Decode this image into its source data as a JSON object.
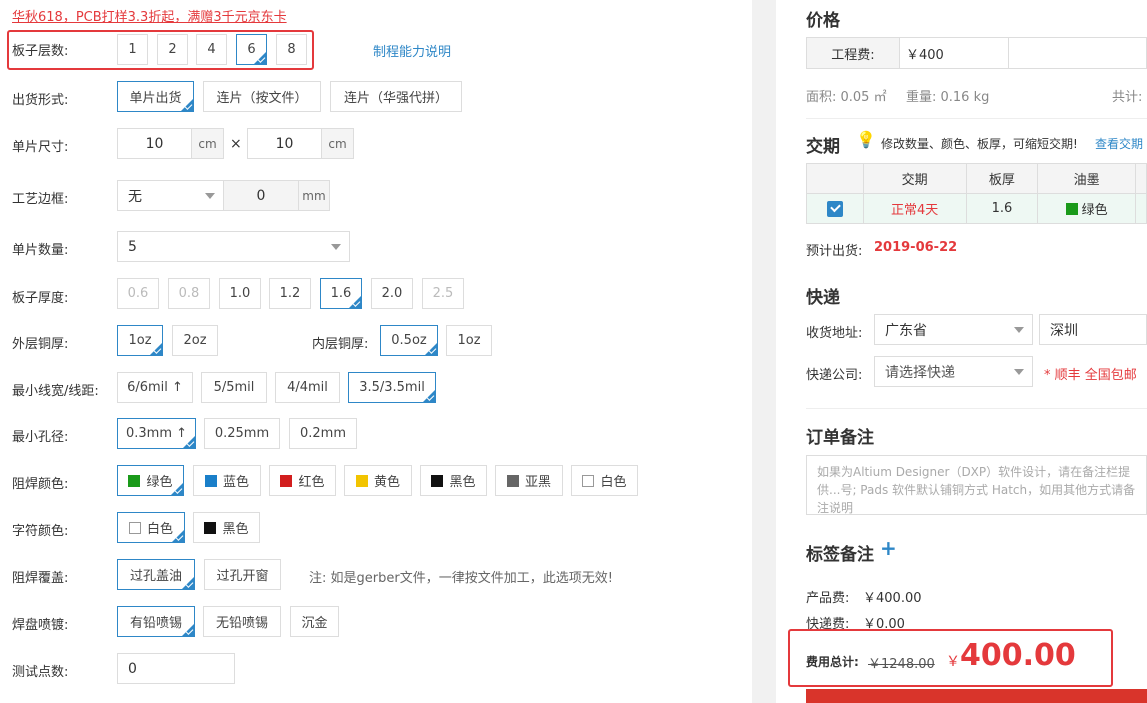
{
  "promo": "华秋618，PCB打样3.3折起，满赠3千元京东卡",
  "layers": {
    "label": "板子层数:",
    "options": [
      "1",
      "2",
      "4",
      "6",
      "8"
    ],
    "link": "制程能力说明"
  },
  "shipping_form": {
    "label": "出货形式:",
    "options": [
      "单片出货",
      "连片（按文件）",
      "连片（华强代拼）"
    ]
  },
  "size": {
    "label": "单片尺寸:",
    "width": "10",
    "height": "10",
    "unit": "cm",
    "times": "×"
  },
  "border": {
    "label": "工艺边框:",
    "select": "无",
    "value": "0",
    "unit": "mm"
  },
  "quantity": {
    "label": "单片数量:",
    "value": "5"
  },
  "thickness": {
    "label": "板子厚度:",
    "options": [
      "0.6",
      "0.8",
      "1.0",
      "1.2",
      "1.6",
      "2.0",
      "2.5"
    ]
  },
  "copper": {
    "outer_label": "外层铜厚:",
    "outer": [
      "1oz",
      "2oz"
    ],
    "inner_label": "内层铜厚:",
    "inner": [
      "0.5oz",
      "1oz"
    ]
  },
  "trace": {
    "label": "最小线宽/线距:",
    "options": [
      "6/6mil ↑",
      "5/5mil",
      "4/4mil",
      "3.5/3.5mil"
    ]
  },
  "hole": {
    "label": "最小孔径:",
    "options": [
      "0.3mm ↑",
      "0.25mm",
      "0.2mm"
    ]
  },
  "mask_color": {
    "label": "阻焊颜色:",
    "options": [
      {
        "name": "绿色",
        "color": "#1a9a1a"
      },
      {
        "name": "蓝色",
        "color": "#1a7fc9"
      },
      {
        "name": "红色",
        "color": "#d21e1e"
      },
      {
        "name": "黄色",
        "color": "#f2c400"
      },
      {
        "name": "黑色",
        "color": "#111111"
      },
      {
        "name": "亚黑",
        "color": "#666666"
      },
      {
        "name": "白色",
        "color": "#ffffff"
      }
    ]
  },
  "silk_color": {
    "label": "字符颜色:",
    "options": [
      {
        "name": "白色",
        "color": "#ffffff"
      },
      {
        "name": "黑色",
        "color": "#111111"
      }
    ]
  },
  "mask_cover": {
    "label": "阻焊覆盖:",
    "options": [
      "过孔盖油",
      "过孔开窗"
    ],
    "note": "注: 如是gerber文件，一律按文件加工，此选项无效!"
  },
  "finish": {
    "label": "焊盘喷镀:",
    "options": [
      "有铅喷锡",
      "无铅喷锡",
      "沉金"
    ]
  },
  "test_points": {
    "label": "测试点数:",
    "value": "0"
  },
  "price": {
    "title": "价格",
    "eng_label": "工程费:",
    "eng_value": "￥400",
    "area": "面积: 0.05 ㎡",
    "weight": "重量: 0.16 kg",
    "total_prefix": "共计:"
  },
  "delivery": {
    "title": "交期",
    "hint": "修改数量、颜色、板厚，可缩短交期!",
    "hint_link": "查看交期",
    "headers": [
      "交期",
      "板厚",
      "油墨"
    ],
    "row": {
      "term": "正常4天",
      "thickness": "1.6",
      "ink": "绿色",
      "ink_color": "#1a9a1a"
    },
    "ship_label": "预计出货:",
    "ship_date": "2019-06-22"
  },
  "express": {
    "title": "快递",
    "addr_label": "收货地址:",
    "province": "广东省",
    "city": "深圳",
    "company_label": "快递公司:",
    "company_placeholder": "请选择快递",
    "note": "* 顺丰 全国包邮"
  },
  "order_note": {
    "title": "订单备注",
    "placeholder": "如果为Altium Designer（DXP）软件设计，请在备注栏提供...号; Pads 软件默认铺铜方式 Hatch，如用其他方式请备注说明"
  },
  "label_note": {
    "title": "标签备注",
    "plus": "+"
  },
  "summary": {
    "product_label": "产品费:",
    "product_value": "￥400.00",
    "express_label": "快递费:",
    "express_value": "￥0.00",
    "total_label": "费用总计:",
    "original": "￥1248.00",
    "currency": "￥",
    "total": "400.00"
  }
}
